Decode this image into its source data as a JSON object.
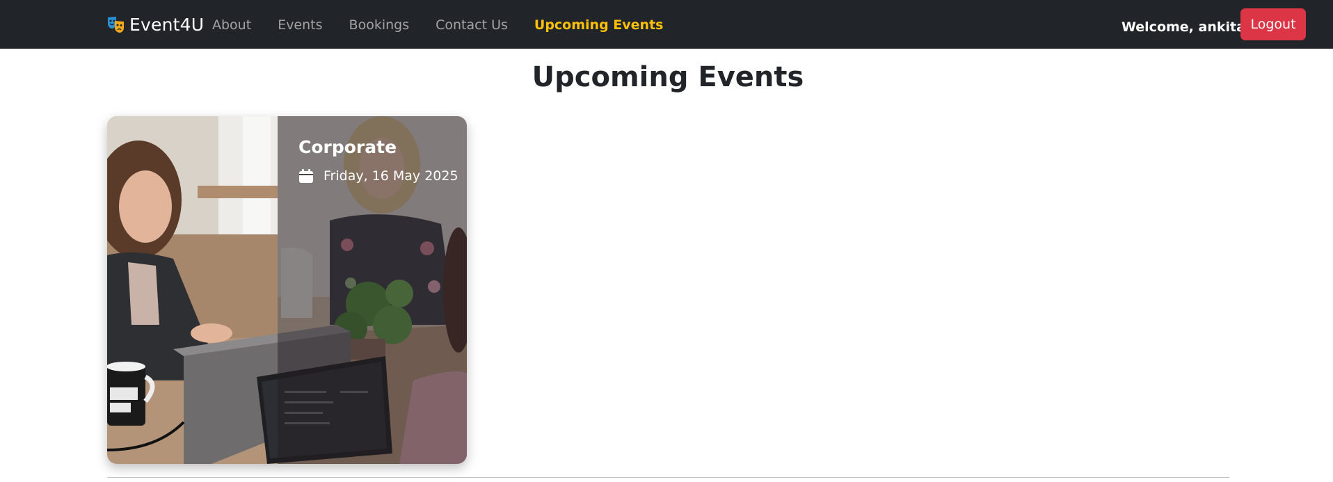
{
  "nav": {
    "brand": "Event4U",
    "brand_icon": "theater-masks-icon",
    "links": [
      "About",
      "Events",
      "Bookings",
      "Contact Us",
      "Upcoming Events"
    ],
    "active_link": "Upcoming Events",
    "welcome": "Welcome, ankita",
    "logout_label": "Logout"
  },
  "page": {
    "title": "Upcoming Events"
  },
  "events": [
    {
      "title": "Corporate",
      "date": "Friday, 16 May 2025",
      "date_icon": "calendar-icon",
      "image": "office-meeting-photo"
    }
  ],
  "colors": {
    "navbar_bg": "#212529",
    "active_link": "#ffc107",
    "logout_bg": "#dc3545"
  }
}
